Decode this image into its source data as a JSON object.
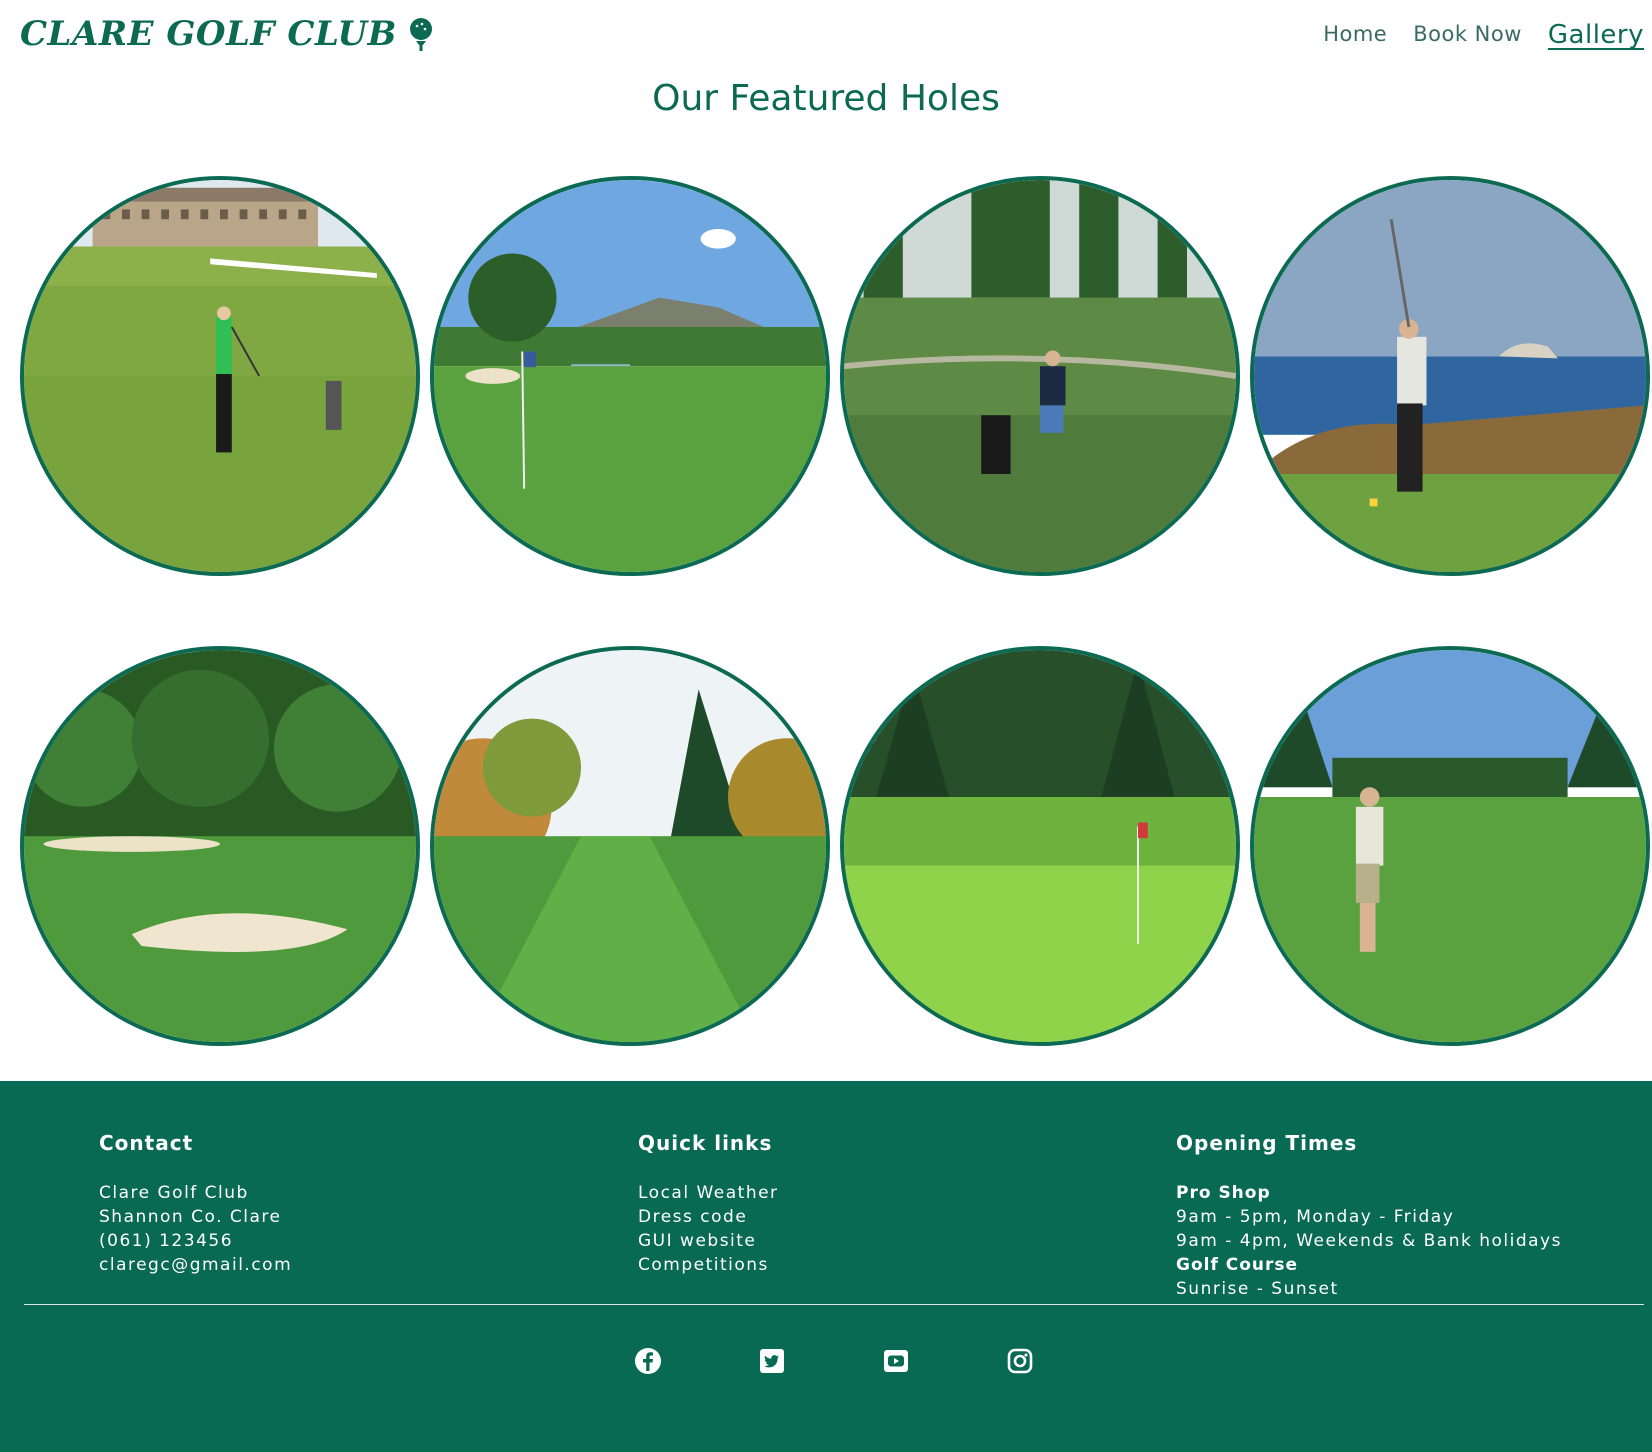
{
  "header": {
    "logo_text": "CLARE GOLF CLUB",
    "logo_icon": "golf-ball-tee-icon",
    "nav": [
      {
        "label": "Home",
        "active": false
      },
      {
        "label": "Book Now",
        "active": false
      },
      {
        "label": "Gallery",
        "active": true
      }
    ]
  },
  "page": {
    "title": "Our Featured Holes"
  },
  "gallery": {
    "images": [
      {
        "scene": "golfer-green-shirt-hotel"
      },
      {
        "scene": "fairway-mountain-flag"
      },
      {
        "scene": "golfer-swing-bag"
      },
      {
        "scene": "golfer-sea-cliff"
      },
      {
        "scene": "bunkers-forest"
      },
      {
        "scene": "autumn-tree-fairway"
      },
      {
        "scene": "green-flag-forest"
      },
      {
        "scene": "golfer-pine-course"
      }
    ]
  },
  "footer": {
    "contact": {
      "heading": "Contact",
      "lines": [
        "Clare Golf Club",
        "Shannon Co. Clare",
        "(061) 123456",
        "claregc@gmail.com"
      ]
    },
    "quick_links": {
      "heading": "Quick links",
      "links": [
        "Local Weather",
        "Dress code",
        "GUI website",
        "Competitions"
      ]
    },
    "opening_times": {
      "heading": "Opening Times",
      "pro_shop_label": "Pro Shop",
      "pro_shop_weekday": "9am - 5pm, Monday - Friday",
      "pro_shop_weekend": "9am - 4pm, Weekends & Bank holidays",
      "course_label": "Golf Course",
      "course_hours": "Sunrise - Sunset"
    },
    "socials": [
      "facebook-icon",
      "twitter-icon",
      "youtube-icon",
      "instagram-icon"
    ]
  },
  "colors": {
    "brand_green": "#0c6a52",
    "footer_bg": "#086a52"
  }
}
